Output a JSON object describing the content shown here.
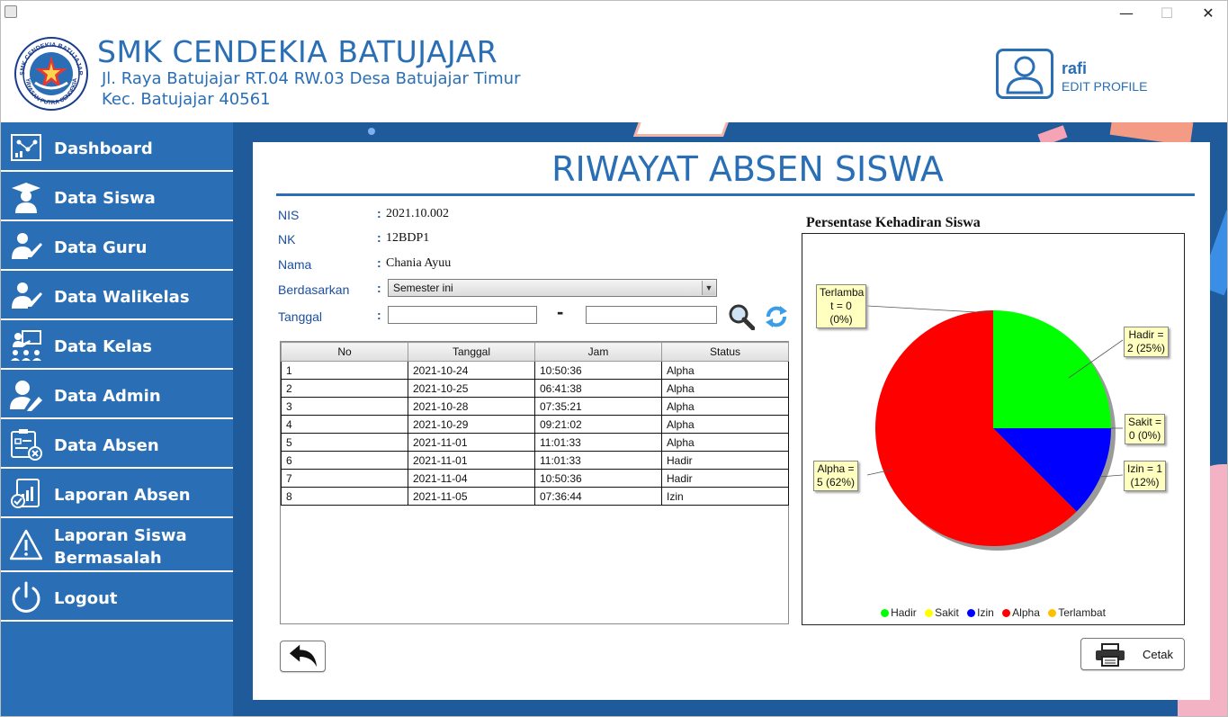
{
  "window": {
    "minimize": "—",
    "maximize": "☐",
    "close": "✕"
  },
  "header": {
    "school_name": "SMK CENDEKIA BATUJAJAR",
    "address_line1": "Jl. Raya Batujajar RT.04 RW.03 Desa Batujajar Timur",
    "address_line2": "Kec. Batujajar 40561",
    "logo_text": "SMK CENDEKIA BATUJAJAR",
    "logo_footer": "YAYASAN PUTRA CENDEKIA"
  },
  "profile": {
    "name": "rafi",
    "edit_label": "EDIT PROFILE",
    "icon": "user-icon"
  },
  "sidebar": {
    "items": [
      {
        "label": "Dashboard",
        "icon": "dashboard-icon"
      },
      {
        "label": "Data Siswa",
        "icon": "student-icon"
      },
      {
        "label": "Data Guru",
        "icon": "teacher-icon"
      },
      {
        "label": "Data Walikelas",
        "icon": "homeroom-teacher-icon"
      },
      {
        "label": "Data Kelas",
        "icon": "classroom-icon"
      },
      {
        "label": "Data Admin",
        "icon": "admin-icon"
      },
      {
        "label": "Data Absen",
        "icon": "attendance-data-icon"
      },
      {
        "label": "Laporan Absen",
        "icon": "report-icon"
      },
      {
        "label": "Laporan Siswa Bermasalah",
        "icon": "warning-icon"
      },
      {
        "label": "Logout",
        "icon": "power-icon"
      }
    ]
  },
  "page": {
    "title": "RIWAYAT ABSEN SISWA"
  },
  "form": {
    "colon": ":",
    "nis_label": "NIS",
    "nis_value": "2021.10.002",
    "nk_label": "NK",
    "nk_value": "12BDP1",
    "nama_label": "Nama",
    "nama_value": "Chania Ayuu",
    "berdasarkan_label": "Berdasarkan",
    "berdasarkan_value": "Semester ini",
    "tanggal_label": "Tanggal",
    "tanggal_from": "",
    "tanggal_to": "",
    "dash": "-"
  },
  "table": {
    "headers": [
      "No",
      "Tanggal",
      "Jam",
      "Status"
    ],
    "rows": [
      [
        "1",
        "2021-10-24",
        "10:50:36",
        "Alpha"
      ],
      [
        "2",
        "2021-10-25",
        "06:41:38",
        "Alpha"
      ],
      [
        "3",
        "2021-10-28",
        "07:35:21",
        "Alpha"
      ],
      [
        "4",
        "2021-10-29",
        "09:21:02",
        "Alpha"
      ],
      [
        "5",
        "2021-11-01",
        "11:01:33",
        "Alpha"
      ],
      [
        "6",
        "2021-11-01",
        "11:01:33",
        "Hadir"
      ],
      [
        "7",
        "2021-11-04",
        "10:50:36",
        "Hadir"
      ],
      [
        "8",
        "2021-11-05",
        "07:36:44",
        "Izin"
      ]
    ]
  },
  "chart_data": {
    "type": "pie",
    "title": "Persentase Kehadiran Siswa",
    "categories": [
      "Hadir",
      "Sakit",
      "Izin",
      "Alpha",
      "Terlambat"
    ],
    "values": [
      2,
      0,
      1,
      5,
      0
    ],
    "percents": [
      "25%",
      "0%",
      "12%",
      "62%",
      "0%"
    ],
    "colors": [
      "#00ff00",
      "#ffff00",
      "#0000ff",
      "#ff0000",
      "#ffc000"
    ],
    "labels": {
      "hadir": [
        "Hadir =",
        "2 (25%)"
      ],
      "sakit": [
        "Sakit =",
        "0 (0%)"
      ],
      "izin": [
        "Izin = 1",
        "(12%)"
      ],
      "alpha": [
        "Alpha =",
        "5 (62%)"
      ],
      "terlambat": [
        "Terlamba",
        "t = 0",
        "(0%)"
      ]
    },
    "legend_position": "bottom"
  },
  "actions": {
    "cetak_label": "Cetak",
    "back_icon": "back-arrow-icon",
    "print_icon": "printer-icon"
  }
}
